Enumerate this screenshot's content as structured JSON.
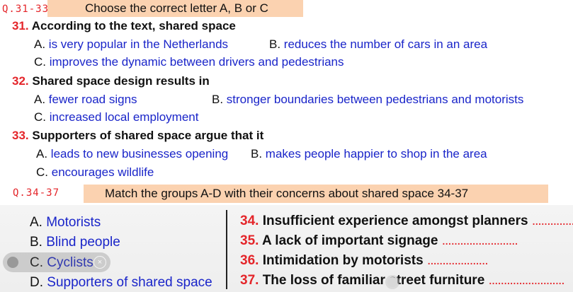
{
  "section1": {
    "label": "Q.31-33",
    "instruction": "Choose the correct letter A, B or C",
    "questions": [
      {
        "number": "31.",
        "text": "According to the text, shared space",
        "options": [
          {
            "letter": "A.",
            "text": "is very popular in the Netherlands"
          },
          {
            "letter": "B.",
            "text": "reduces the number of cars in an area"
          },
          {
            "letter": "C.",
            "text": "improves the dynamic between drivers and pedestrians"
          }
        ]
      },
      {
        "number": "32.",
        "text": "Shared space design results in",
        "options": [
          {
            "letter": "A.",
            "text": "fewer road signs"
          },
          {
            "letter": "B.",
            "text": "stronger boundaries between pedestrians and motorists"
          },
          {
            "letter": "C.",
            "text": "increased local employment"
          }
        ]
      },
      {
        "number": "33.",
        "text": "Supporters of shared space argue that it",
        "options": [
          {
            "letter": "A.",
            "text": "leads to new businesses opening"
          },
          {
            "letter": "B.",
            "text": "makes people happier to shop in the area"
          },
          {
            "letter": "C.",
            "text": "encourages wildlife"
          }
        ]
      }
    ]
  },
  "section2": {
    "label": "Q.34-37",
    "instruction": "Match the groups A-D with their concerns about shared space 34-37",
    "groups": [
      {
        "letter": "A.",
        "text": "Motorists"
      },
      {
        "letter": "B.",
        "text": "Blind people"
      },
      {
        "letter": "C.",
        "text": "Cyclists"
      },
      {
        "letter": "D.",
        "text": "Supporters of shared space"
      }
    ],
    "concerns": [
      {
        "number": "34.",
        "text": "Insufficient experience amongst planners",
        "dots": ".............."
      },
      {
        "number": "35.",
        "text": "A lack of important signage",
        "dots": "........................."
      },
      {
        "number": "36.",
        "text": "Intimidation by motorists",
        "dots": "...................."
      },
      {
        "number": "37.",
        "text": "The loss of familiar street furniture",
        "dots": "........................."
      }
    ]
  },
  "overlay": {
    "close_glyph": "×"
  }
}
